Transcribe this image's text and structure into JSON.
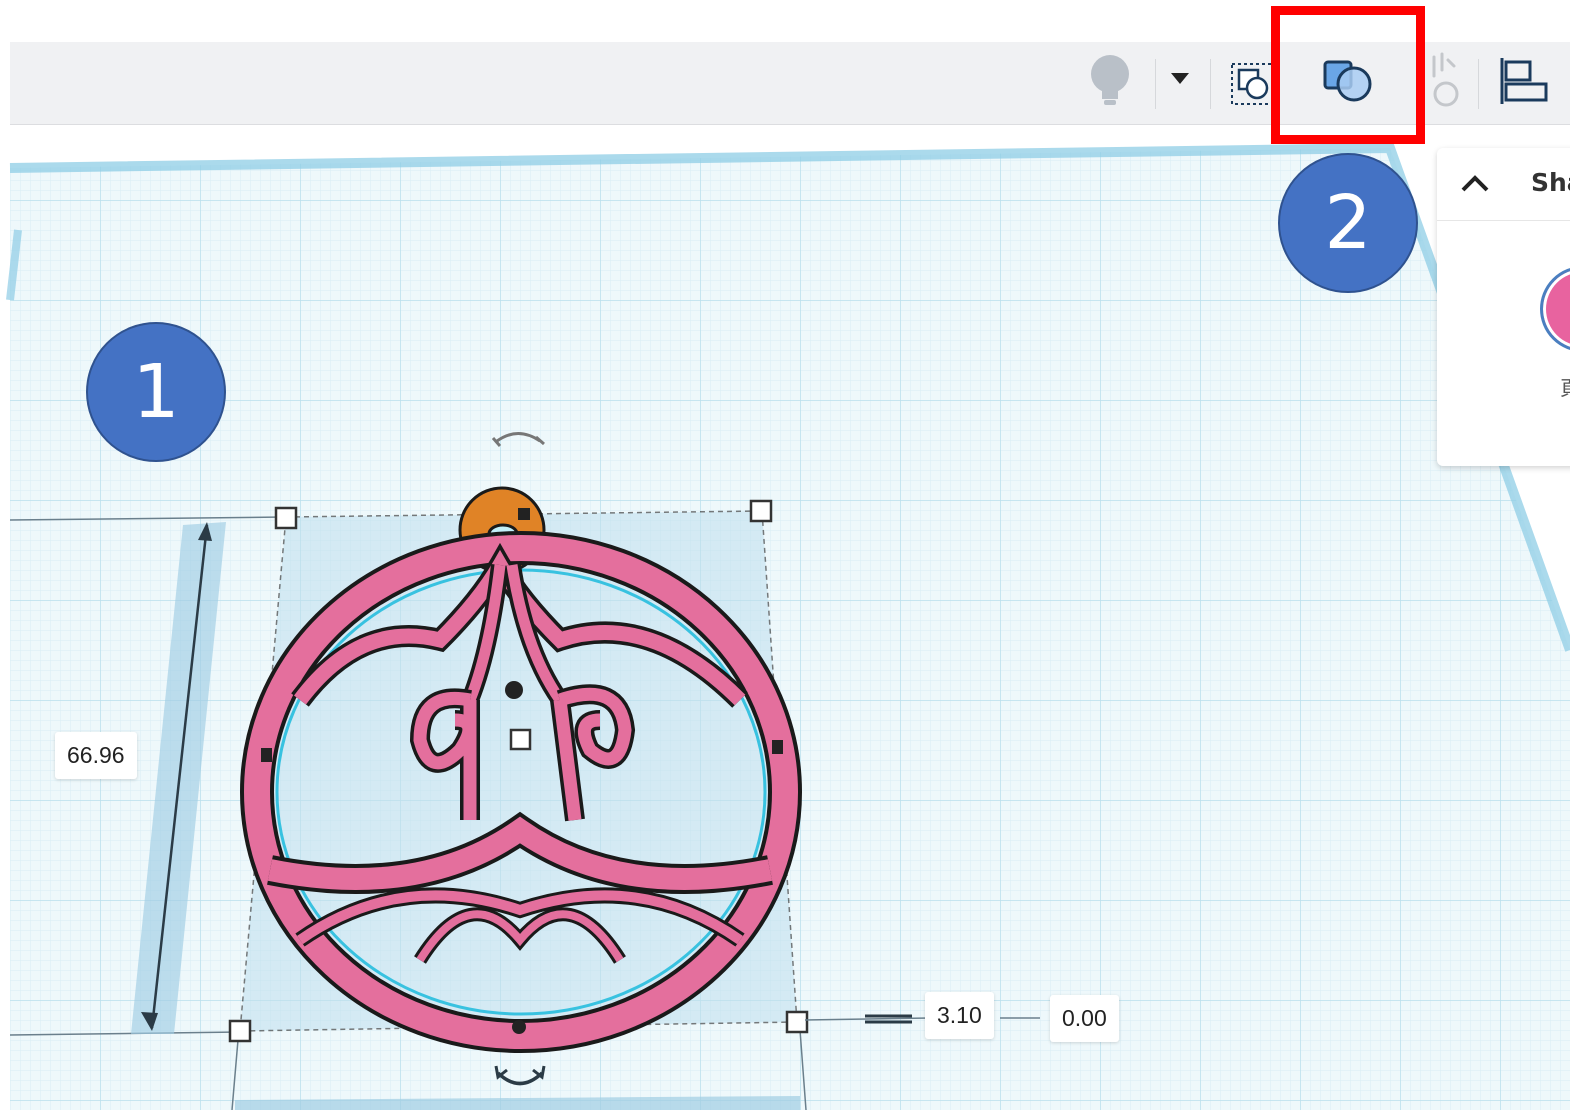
{
  "toolbar": {
    "buttons": [
      {
        "name": "lightbulb-icon"
      },
      {
        "name": "dropdown-caret-icon"
      },
      {
        "name": "group-icon"
      },
      {
        "name": "ungroup-icon"
      },
      {
        "name": "workplane-icon"
      },
      {
        "name": "align-icon"
      }
    ]
  },
  "inspector": {
    "title": "Sha",
    "subtitle": "頁",
    "collapse_icon": "chevron-up-icon",
    "swatch_color": "#e8639f"
  },
  "annotations": {
    "step1_label": "1",
    "step2_label": "2",
    "badge_color": "#4472c4",
    "highlight_color": "#ff0000"
  },
  "workplane": {
    "height_dimension": "66.96",
    "elevation_dimension": "3.10",
    "offset_dimension": "0.00",
    "shape_color": "#e46f9d",
    "hole_color": "#e08326",
    "grid_color": "#cde9f3"
  }
}
